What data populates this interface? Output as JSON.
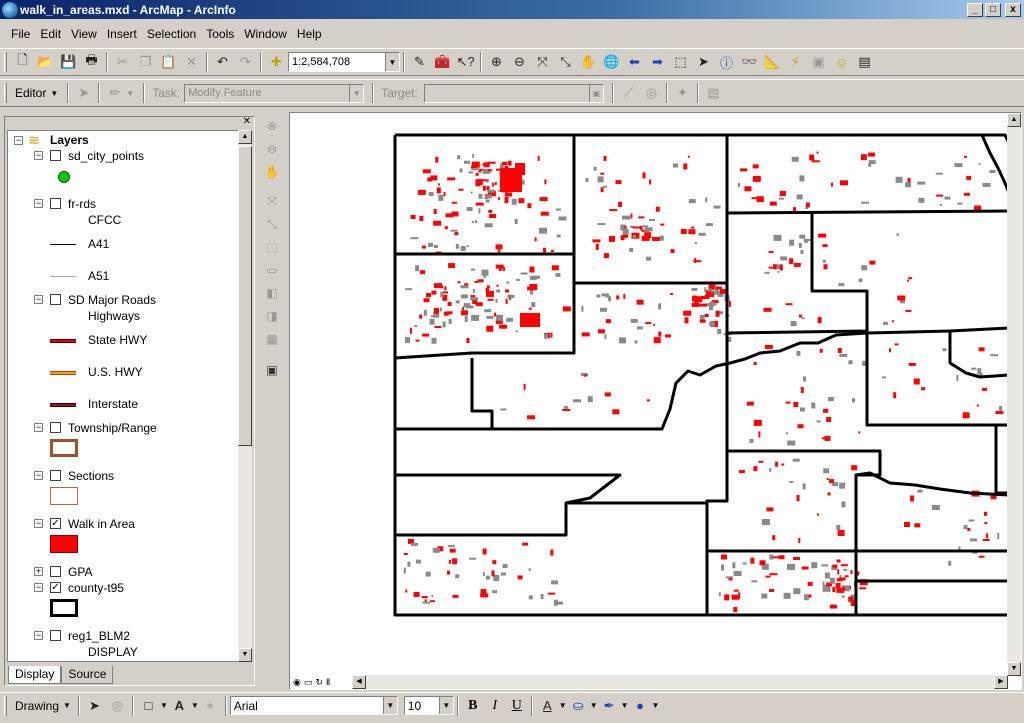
{
  "window": {
    "title": "walk_in_areas.mxd - ArcMap - ArcInfo",
    "controls": [
      "_",
      "□",
      "x"
    ]
  },
  "menu": [
    "File",
    "Edit",
    "View",
    "Insert",
    "Selection",
    "Tools",
    "Window",
    "Help"
  ],
  "standard_toolbar": {
    "scale": "1:2,584,708"
  },
  "editor_toolbar": {
    "editor_label": "Editor",
    "task_label": "Task:",
    "task_value": "Modify Feature",
    "target_label": "Target:"
  },
  "toc": {
    "root": "Layers",
    "layers": [
      {
        "name": "sd_city_points",
        "checked": false
      },
      {
        "name": "fr-rds",
        "checked": false,
        "field": "CFCC",
        "classes": [
          "A41",
          "A51"
        ]
      },
      {
        "name": "SD Major Roads",
        "checked": false,
        "field": "Highways",
        "classes": [
          "State HWY",
          "U.S. HWY",
          "Interstate"
        ]
      },
      {
        "name": "Township/Range",
        "checked": false
      },
      {
        "name": "Sections",
        "checked": false
      },
      {
        "name": "Walk in Area",
        "checked": true
      },
      {
        "name": "GPA",
        "checked": false
      },
      {
        "name": "county-t95",
        "checked": true
      },
      {
        "name": "reg1_BLM2",
        "checked": false,
        "field": "DISPLAY"
      }
    ],
    "tabs": [
      "Display",
      "Source"
    ]
  },
  "drawing_toolbar": {
    "drawing_label": "Drawing",
    "font": "Arial",
    "size": "10",
    "bold": "B",
    "italic": "I",
    "underline": "U"
  },
  "colors": {
    "title_bar": "#0a246a",
    "walk_in_area": "#ff0000",
    "city_point": "#00cc00",
    "township": "#a0522d",
    "state_hwy": "#e00000",
    "us_hwy": "#f0a020",
    "interstate": "#8b1a1a"
  }
}
